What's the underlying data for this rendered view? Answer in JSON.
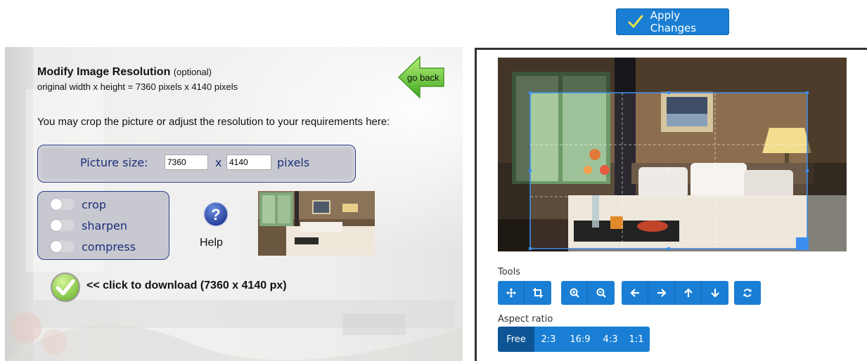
{
  "apply_button": {
    "label": "Apply Changes"
  },
  "left": {
    "title_bold": "Modify Image Resolution",
    "title_optional": "(optional)",
    "original_size": "original width x height = 7360 pixels x 4140 pixels",
    "go_back_label": "go back",
    "instruction": "You may crop the picture or adjust the resolution to your requirements here:",
    "picture_size": {
      "label": "Picture size:",
      "width_value": "7360",
      "times": "x",
      "height_value": "4140",
      "unit": "pixels"
    },
    "options": [
      {
        "label": "crop",
        "on": false
      },
      {
        "label": "sharpen",
        "on": false
      },
      {
        "label": "compress",
        "on": false
      }
    ],
    "help_label": "Help",
    "download_label": "<< click to download (7360 x 4140 px)"
  },
  "right": {
    "tools_label": "Tools",
    "aspect_label": "Aspect ratio",
    "tool_groups": [
      [
        "move-icon",
        "crop-icon"
      ],
      [
        "zoom-in-icon",
        "zoom-out-icon"
      ],
      [
        "arrow-left-icon",
        "arrow-right-icon",
        "arrow-up-icon",
        "arrow-down-icon"
      ],
      [
        "rotate-icon"
      ]
    ],
    "aspect_ratios": [
      "Free",
      "2:3",
      "16:9",
      "4:3",
      "1:1"
    ],
    "aspect_selected": "Free"
  },
  "colors": {
    "accent": "#1a7fd4",
    "accent_active": "#0e5596",
    "panel_border": "#2c3e8a",
    "panel_fill": "#c8c8d0",
    "label_text": "#1a2f7a"
  }
}
